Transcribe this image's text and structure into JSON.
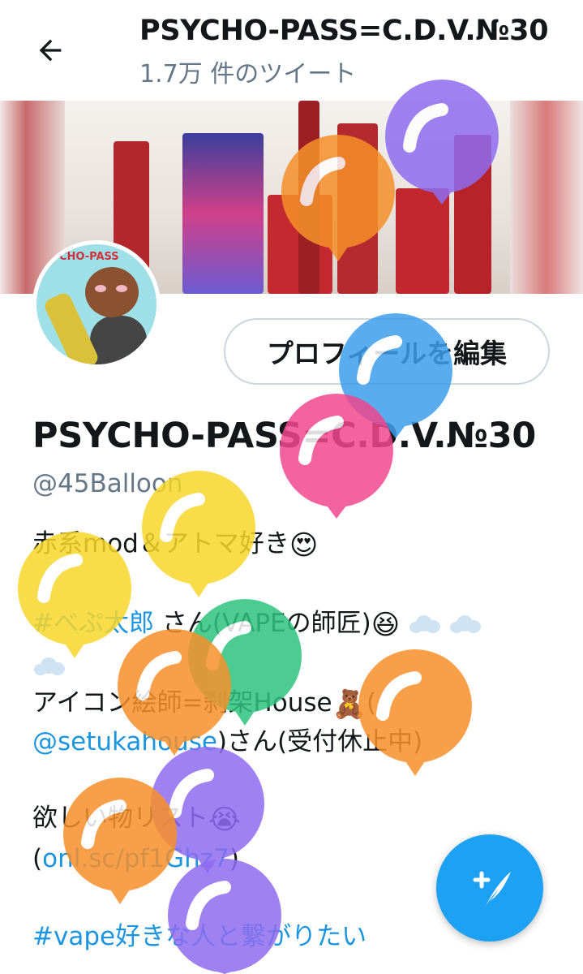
{
  "header": {
    "title": "PSYCHO-PASS=C.D.V.№30",
    "tweet_count": "1.7万 件のツイート"
  },
  "profile": {
    "edit_button": "プロフィールを編集",
    "name": "PSYCHO-PASS=C.D.V.№30",
    "handle": "@45Balloon",
    "avatar_ring_text": "CHO-PASS"
  },
  "bio": {
    "line1_text": "赤系mod＆アトマ好き",
    "line1_emoji": "😍",
    "line2_hashtag": "#べぷ太郎",
    "line2_text": "さん(VAPEの師匠)",
    "line2_emoji": "😆",
    "line3_text": "アイコン絵師=刹架House",
    "line3_emoji": "🧸",
    "line3_open": "(",
    "line4_mention": "@setukahouse",
    "line4_text": ")さん(受付休止中)",
    "line5_text": "欲しい物リスト",
    "line5_emoji": "😭",
    "line6_open": "(",
    "line6_link": "onl.sc/pf1Ghz7",
    "line6_close": ")",
    "line7_hashtag": "#vape好きな人と繋がりたい"
  },
  "icons": {
    "back": "arrow-left-icon",
    "compose": "feather-plus-icon",
    "cloud": "thought-cloud-icon",
    "balloon": "balloon-icon"
  },
  "colors": {
    "link": "#1b95e0",
    "fab": "#1da1f2",
    "secondary_text": "#657786",
    "balloon_orange": "#f6902a",
    "balloon_purple": "#8f6cf0",
    "balloon_blue": "#3d9eea",
    "balloon_pink": "#f0488f",
    "balloon_yellow": "#f8d62a",
    "balloon_green": "#2fc47e"
  }
}
